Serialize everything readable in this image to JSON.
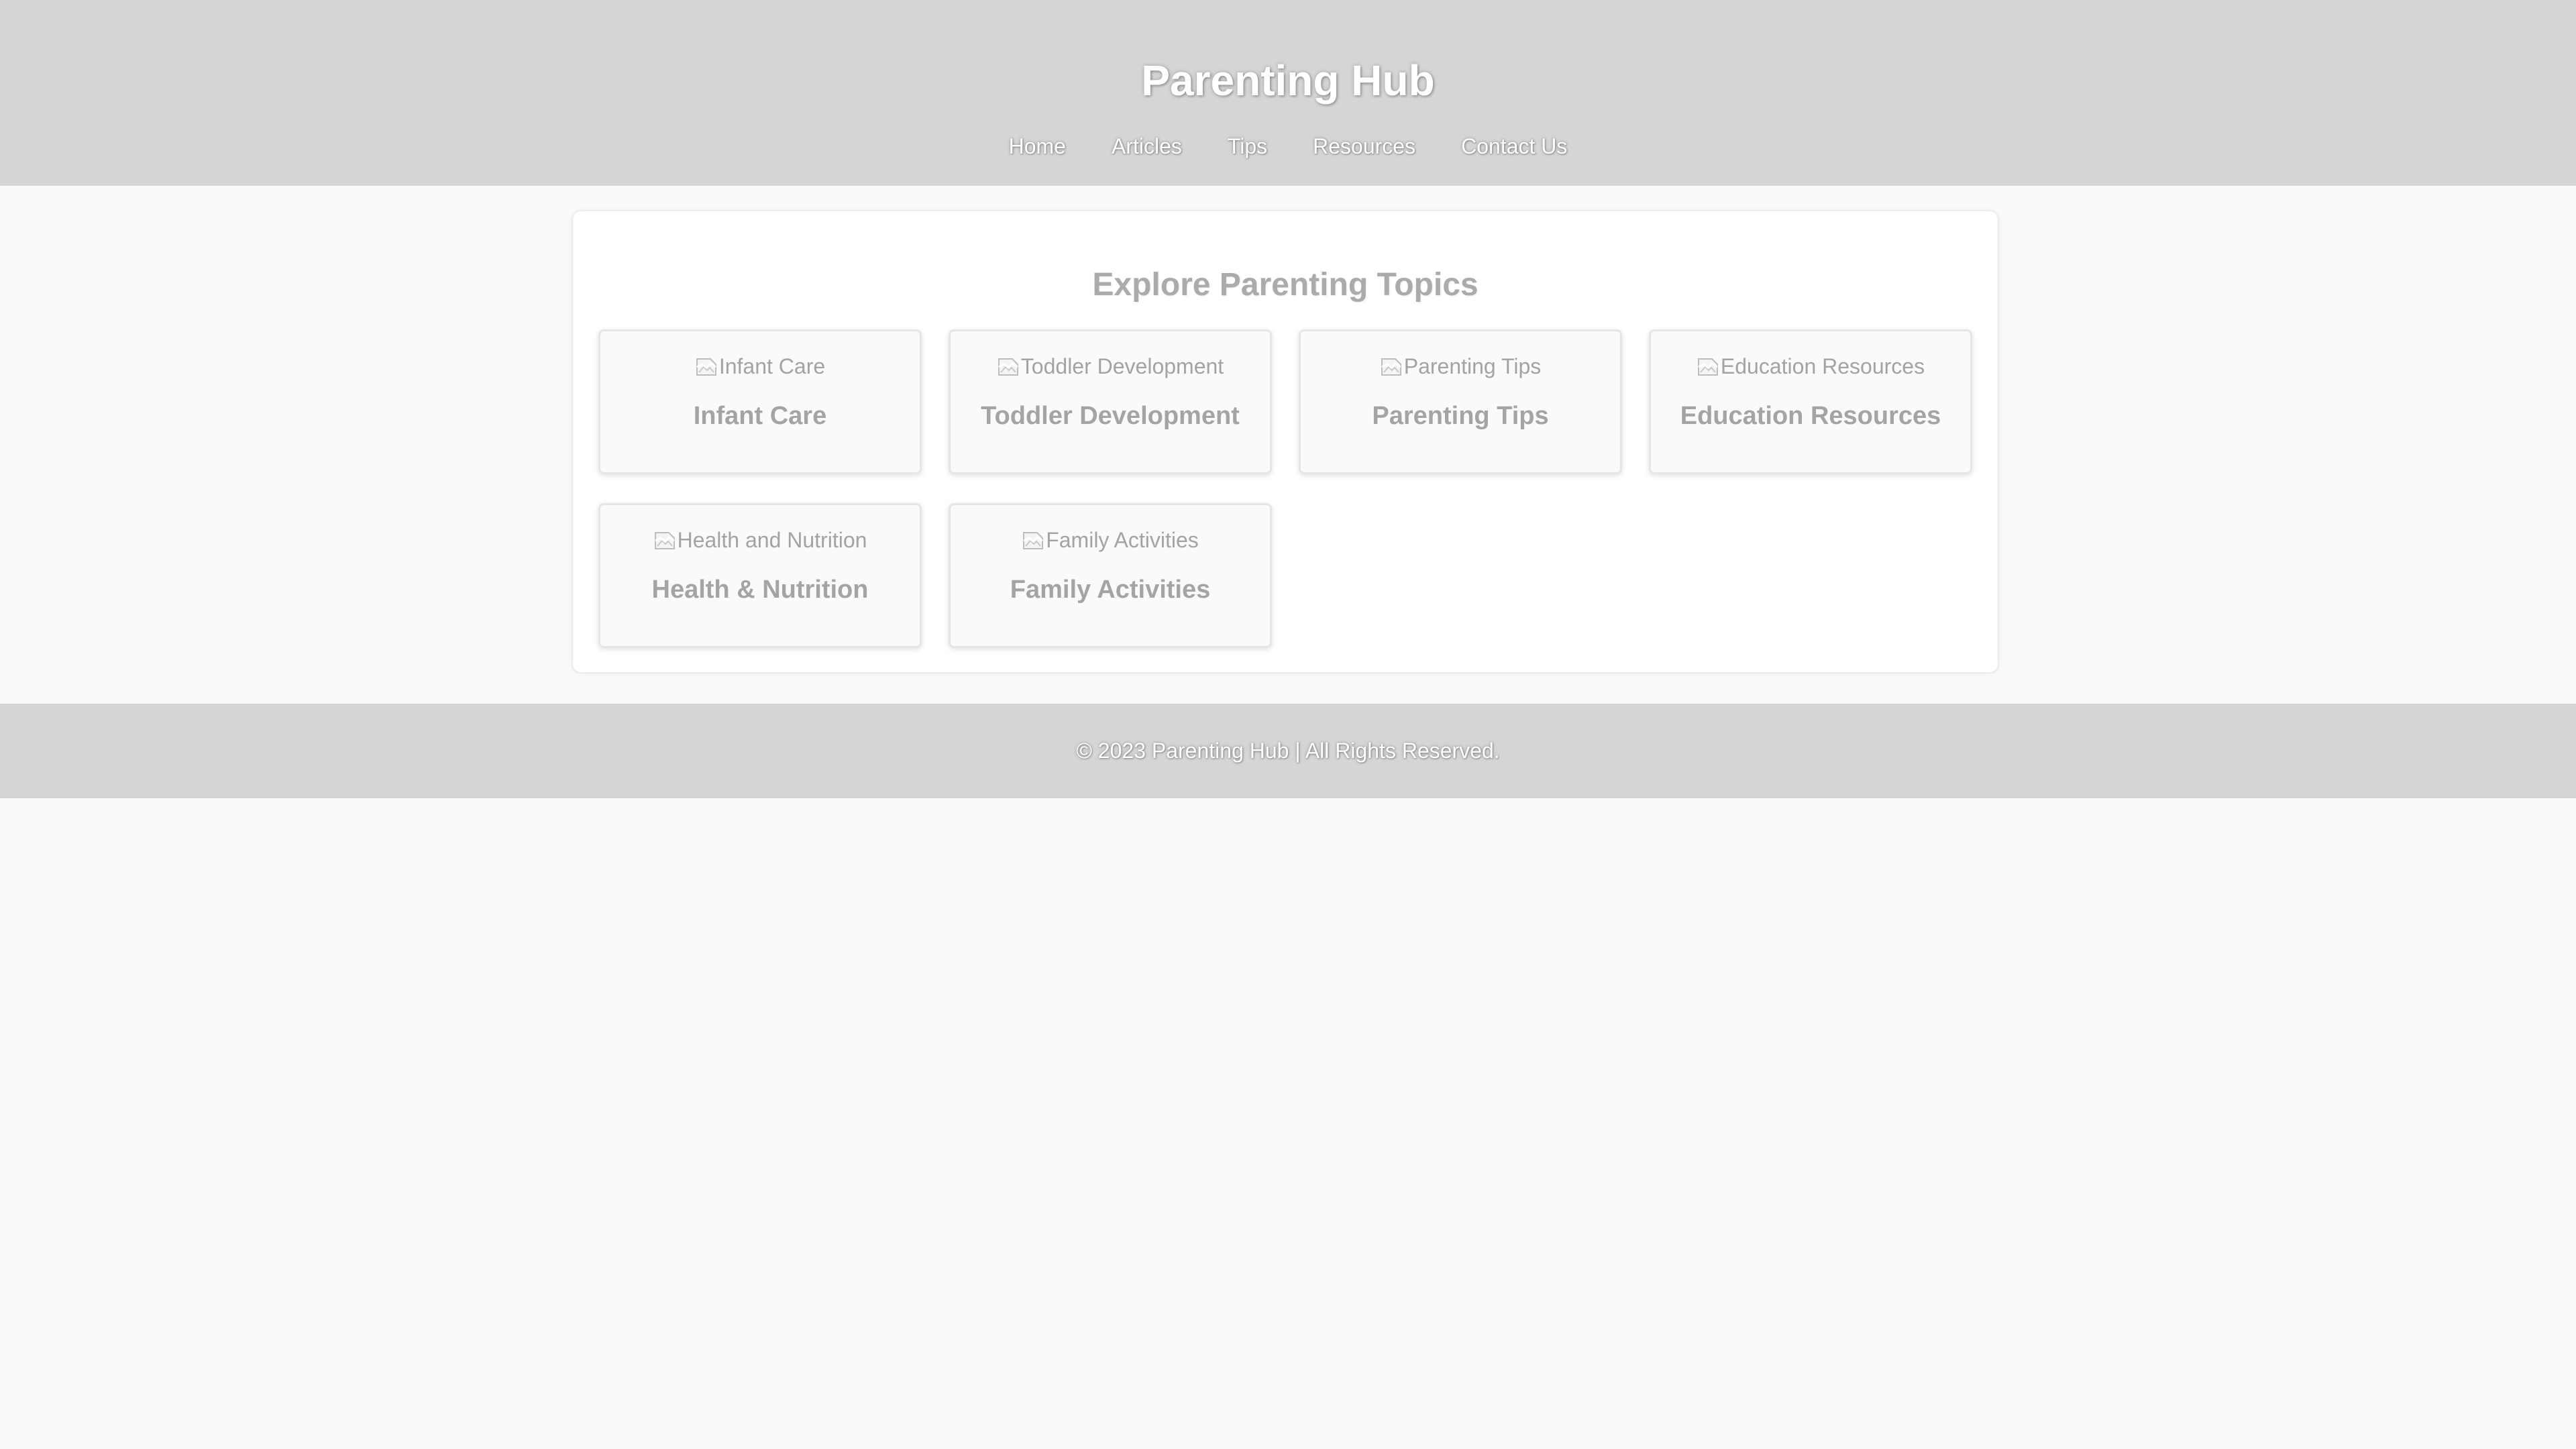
{
  "header": {
    "title": "Parenting Hub",
    "nav": [
      {
        "label": "Home"
      },
      {
        "label": "Articles"
      },
      {
        "label": "Tips"
      },
      {
        "label": "Resources"
      },
      {
        "label": "Contact Us"
      }
    ]
  },
  "main": {
    "section_title": "Explore Parenting Topics",
    "topics": [
      {
        "image_alt": "Infant Care",
        "name": "Infant Care"
      },
      {
        "image_alt": "Toddler Development",
        "name": "Toddler Development"
      },
      {
        "image_alt": "Parenting Tips",
        "name": "Parenting Tips"
      },
      {
        "image_alt": "Education Resources",
        "name": "Education Resources"
      },
      {
        "image_alt": "Health and Nutrition",
        "name": "Health & Nutrition"
      },
      {
        "image_alt": "Family Activities",
        "name": "Family Activities"
      }
    ]
  },
  "footer": {
    "text": "© 2023 Parenting Hub | All Rights Reserved."
  },
  "colors": {
    "header_bg": "#d5d5d5",
    "page_bg": "#fafafa",
    "panel_bg": "#ffffff",
    "muted_text": "#a4a4a4"
  },
  "icons": {
    "topic_image": "broken-image-icon"
  }
}
